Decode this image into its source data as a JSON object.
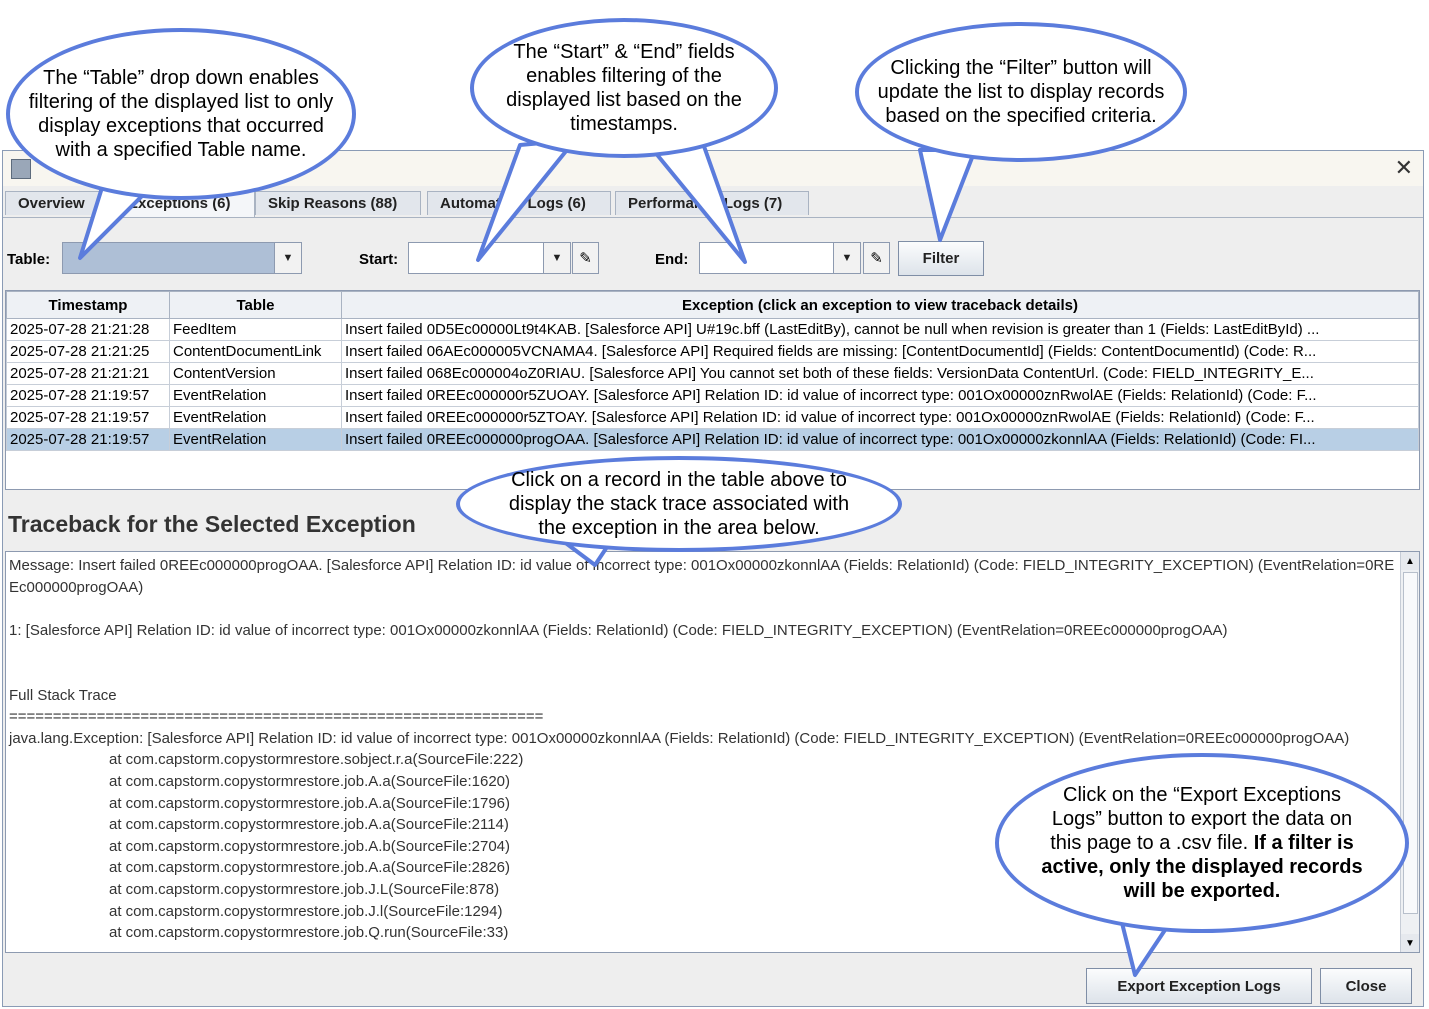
{
  "window": {
    "close_glyph": "✕",
    "app_icon": "application-icon"
  },
  "tabs": [
    {
      "label": "Overview"
    },
    {
      "label": "Exceptions (6)"
    },
    {
      "label": "Skip Reasons (88)"
    },
    {
      "label": "Automation Logs (6)"
    },
    {
      "label": "Performance Logs (7)"
    }
  ],
  "filters": {
    "table_label": "Table:",
    "start_label": "Start:",
    "end_label": "End:",
    "filter_button": "Filter",
    "dropdown_glyph": "▼",
    "edit_glyph": "✎"
  },
  "grid": {
    "headers": [
      "Timestamp",
      "Table",
      "Exception (click an exception to view traceback details)"
    ],
    "rows": [
      [
        "2025-07-28 21:21:28",
        "FeedItem",
        "Insert failed 0D5Ec00000Lt9t4KAB. [Salesforce API] U#19c.bff (LastEditBy), cannot be null when revision is greater than 1 (Fields: LastEditById) ..."
      ],
      [
        "2025-07-28 21:21:25",
        "ContentDocumentLink",
        "Insert failed 06AEc000005VCNAMA4. [Salesforce API] Required fields are missing: [ContentDocumentId] (Fields: ContentDocumentId) (Code: R..."
      ],
      [
        "2025-07-28 21:21:21",
        "ContentVersion",
        "Insert failed 068Ec000004oZ0RIAU. [Salesforce API] You cannot set both of these fields: VersionData ContentUrl. (Code: FIELD_INTEGRITY_E..."
      ],
      [
        "2025-07-28 21:19:57",
        "EventRelation",
        "Insert failed 0REEc000000r5ZUOAY. [Salesforce API] Relation ID: id value of incorrect type: 001Ox00000znRwolAE (Fields: RelationId) (Code: F..."
      ],
      [
        "2025-07-28 21:19:57",
        "EventRelation",
        "Insert failed 0REEc000000r5ZTOAY. [Salesforce API] Relation ID: id value of incorrect type: 001Ox00000znRwolAE (Fields: RelationId) (Code: F..."
      ],
      [
        "2025-07-28 21:19:57",
        "EventRelation",
        "Insert failed 0REEc000000progOAA. [Salesforce API] Relation ID: id value of incorrect type: 001Ox00000zkonnlAA (Fields: RelationId) (Code: FI..."
      ]
    ],
    "selected_row": 5
  },
  "traceback": {
    "title": "Traceback for the Selected Exception",
    "message": "Message: Insert failed 0REEc000000progOAA. [Salesforce API] Relation ID: id value of incorrect type: 001Ox00000zkonnlAA (Fields: RelationId) (Code: FIELD_INTEGRITY_EXCEPTION) (EventRelation=0REEc000000progOAA)",
    "detail": "1: [Salesforce API] Relation ID: id value of incorrect type: 001Ox00000zkonnlAA (Fields: RelationId) (Code: FIELD_INTEGRITY_EXCEPTION) (EventRelation=0REEc000000progOAA)",
    "stack_heading": "Full Stack Trace",
    "separator": "=============================================================",
    "exception": "java.lang.Exception: [Salesforce API] Relation ID: id value of incorrect type: 001Ox00000zkonnlAA (Fields: RelationId) (Code: FIELD_INTEGRITY_EXCEPTION) (EventRelation=0REEc000000progOAA)",
    "frames": [
      "at com.capstorm.copystormrestore.sobject.r.a(SourceFile:222)",
      "at com.capstorm.copystormrestore.job.A.a(SourceFile:1620)",
      "at com.capstorm.copystormrestore.job.A.a(SourceFile:1796)",
      "at com.capstorm.copystormrestore.job.A.a(SourceFile:2114)",
      "at com.capstorm.copystormrestore.job.A.b(SourceFile:2704)",
      "at com.capstorm.copystormrestore.job.A.a(SourceFile:2826)",
      "at com.capstorm.copystormrestore.job.J.L(SourceFile:878)",
      "at com.capstorm.copystormrestore.job.J.l(SourceFile:1294)",
      "at com.capstorm.copystormrestore.job.Q.run(SourceFile:33)"
    ]
  },
  "footer": {
    "export_button": "Export Exception Logs",
    "close_button": "Close"
  },
  "callouts": {
    "table": "The “Table” drop down enables filtering of the displayed list to only display exceptions that occurred with a specified Table name.",
    "dates": "The “Start” & “End” fields enables filtering of the displayed list based on the timestamps.",
    "filter": "Clicking the “Filter” button will update the list to display records based on the specified criteria.",
    "record": "Click on a record in the table above to display the stack trace associated with the exception in the area below.",
    "export_plain": "Click on the “Export Exceptions Logs” button to export the data on this page to a .csv file.",
    "export_bold": "If a filter is active, only the displayed records will be exported."
  },
  "colors": {
    "callout_border": "#5b7cdc",
    "selected_row": "#b8cfe5",
    "combo_fill": "#aebfd6"
  }
}
